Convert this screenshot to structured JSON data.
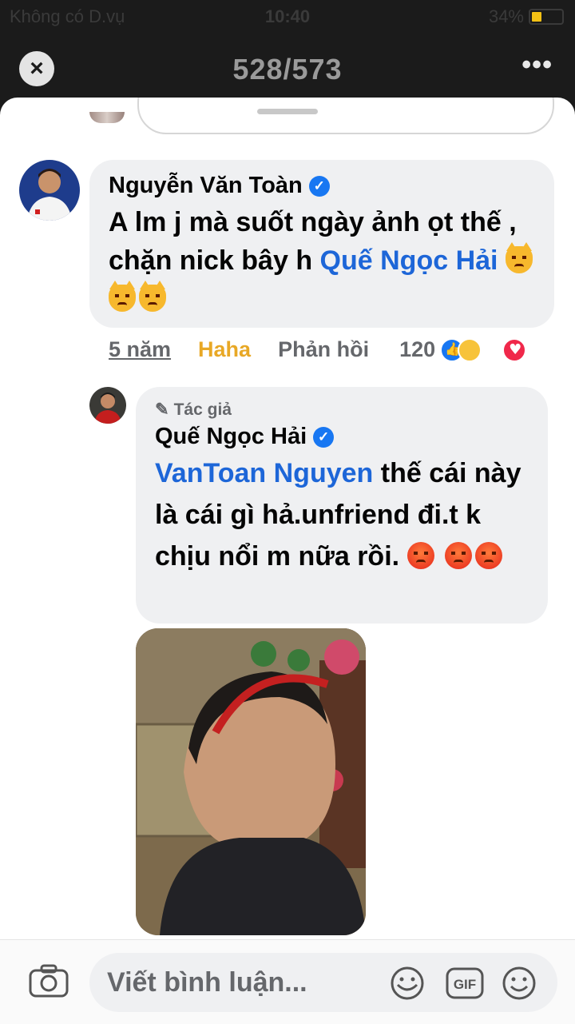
{
  "status_bar": {
    "carrier": "Không có D.vụ",
    "time": "10:40",
    "battery": "34%",
    "battery_level": 0.34
  },
  "header": {
    "counter": "528/573"
  },
  "comments": [
    {
      "author": "Nguyễn Văn Toàn",
      "verified": true,
      "text": "A lm j mà suốt ngày ảnh ọt thế , chặn nick bây h",
      "mention": "Quế Ngọc Hải",
      "emojis": [
        "pouting-cat",
        "pouting-cat",
        "pouting-cat"
      ],
      "time": "5 năm",
      "reaction_label": "Haha",
      "reply_label": "Phản hồi",
      "reaction_count": "120",
      "reaction_icons": [
        "like",
        "haha",
        "love"
      ]
    },
    {
      "author_tag": "Tác giả",
      "author": "Quế Ngọc Hải",
      "verified": true,
      "mention": "VanToan Nguyen",
      "text": "thế cái này là cái gì hả.unfriend đi.t k chịu nổi m nữa rồi.",
      "emojis": [
        "angry-face",
        "angry-face",
        "angry-face"
      ],
      "has_photo": true
    }
  ],
  "composer": {
    "placeholder": "Viết bình luận...",
    "gif_label": "GIF"
  },
  "colors": {
    "link": "#1d66d8",
    "haha": "#e8a826",
    "verified": "#1877f2",
    "bubble": "#eff0f2"
  }
}
